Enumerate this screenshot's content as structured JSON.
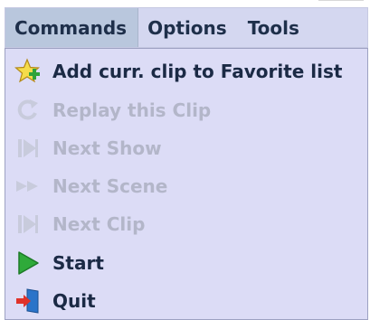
{
  "menubar": {
    "menus": [
      {
        "label": "Commands"
      },
      {
        "label": "Options"
      },
      {
        "label": "Tools"
      }
    ]
  },
  "dropdown": {
    "items": [
      {
        "label": "Add curr. clip to Favorite list",
        "icon": "favorite-star-add-icon"
      },
      {
        "label": "Replay this Clip",
        "icon": "replay-icon"
      },
      {
        "label": "Next Show",
        "icon": "next-show-icon"
      },
      {
        "label": "Next Scene",
        "icon": "fast-forward-icon"
      },
      {
        "label": "Next Clip",
        "icon": "next-clip-icon"
      },
      {
        "label": "Start",
        "icon": "play-icon"
      },
      {
        "label": "Quit",
        "icon": "exit-door-icon"
      }
    ]
  },
  "colors": {
    "menubar_bg": "#d4d7f0",
    "menu_active_bg": "#b9c7dd",
    "dropdown_bg": "#dcdcf6",
    "text": "#1b2a45",
    "disabled_text": "#b3b6c9",
    "play_green": "#2faa3a",
    "exit_red": "#e0322a",
    "exit_blue": "#2b74c9"
  }
}
